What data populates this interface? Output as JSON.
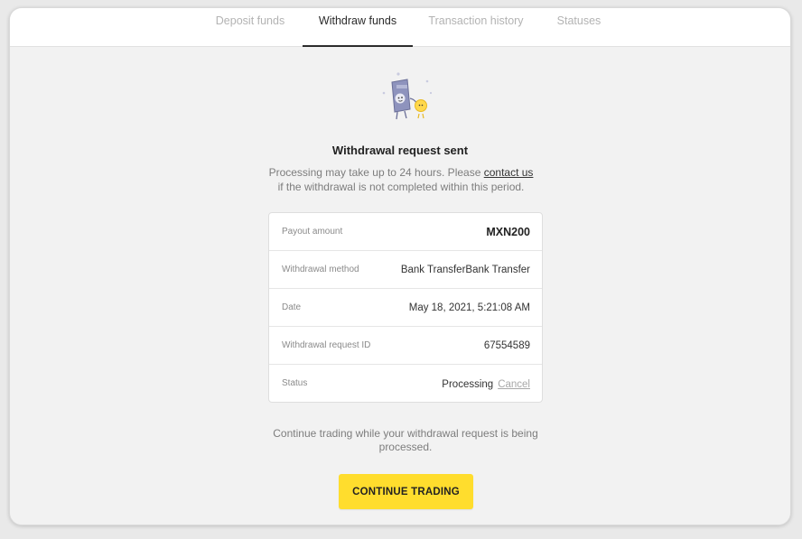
{
  "tabs": [
    {
      "label": "Deposit funds",
      "active": false
    },
    {
      "label": "Withdraw funds",
      "active": true
    },
    {
      "label": "Transaction history",
      "active": false
    },
    {
      "label": "Statuses",
      "active": false
    }
  ],
  "confirmation": {
    "title": "Withdrawal request sent",
    "subtitle_before": "Processing may take up to 24 hours. Please ",
    "contact_link": "contact us",
    "subtitle_after": " if the withdrawal is not completed within this period."
  },
  "details": {
    "payout_amount": {
      "label": "Payout amount",
      "value": "MXN200"
    },
    "method": {
      "label": "Withdrawal method",
      "value": "Bank TransferBank Transfer"
    },
    "date": {
      "label": "Date",
      "value": "May 18, 2021, 5:21:08 AM"
    },
    "request_id": {
      "label": "Withdrawal request ID",
      "value": "67554589"
    },
    "status": {
      "label": "Status",
      "value": "Processing",
      "cancel_label": "Cancel"
    }
  },
  "note": "Continue trading while your withdrawal request is being processed.",
  "cta": {
    "label": "CONTINUE TRADING"
  },
  "colors": {
    "accent": "#ffdd2d",
    "background": "#f2f2f2",
    "card": "#ffffff"
  },
  "icons": {
    "illustration": "banknote-and-coin-characters-illustration"
  }
}
